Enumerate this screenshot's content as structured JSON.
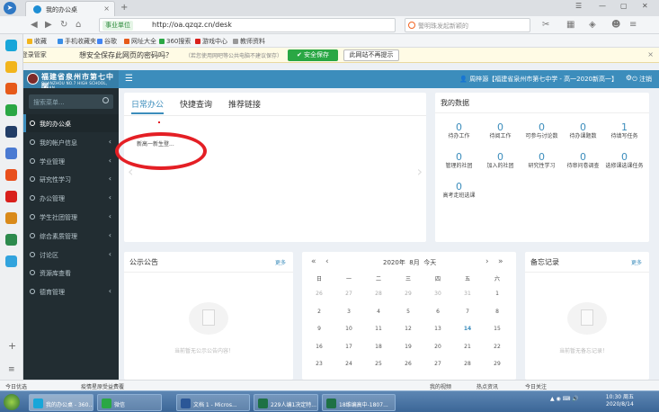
{
  "browser": {
    "tab_title": "我的办公桌",
    "url_badge": "事业单位",
    "url": "http://oa.qzqz.cn/desk",
    "search_placeholder": "警明珠发起新颖的",
    "bookmarks": [
      "收藏",
      "手机收藏夹",
      "谷歌",
      "网址大全",
      "360搜索",
      "游戏中心",
      "教师资料"
    ]
  },
  "password_bar": {
    "brand": "360",
    "brand_sub": "登录管家",
    "prompt": "想安全保存此网页的密码吗？",
    "hint": "（若您使用网吧等公共电脑不建议保存）",
    "save_label": "安全保存",
    "never_label": "此网站不再提示"
  },
  "header": {
    "school_cn": "福建省泉州市第七中学",
    "school_en": "QUANZHOU NO.7 HIGH SCHOOL, FUJIAN",
    "user": "周梓源【福建省泉州市第七中学 - 高一2020新高一】",
    "logout": "注销"
  },
  "sidebar": {
    "search_placeholder": "搜索菜单...",
    "items": [
      {
        "label": "我的办公桌",
        "active": true,
        "chevron": false
      },
      {
        "label": "我的帐户信息",
        "active": false,
        "chevron": true
      },
      {
        "label": "学业管理",
        "active": false,
        "chevron": true
      },
      {
        "label": "研究性学习",
        "active": false,
        "chevron": true
      },
      {
        "label": "办公管理",
        "active": false,
        "chevron": true
      },
      {
        "label": "学生社团管理",
        "active": false,
        "chevron": true
      },
      {
        "label": "综合素质管理",
        "active": false,
        "chevron": true
      },
      {
        "label": "讨论区",
        "active": false,
        "chevron": true
      },
      {
        "label": "资源库查看",
        "active": false,
        "chevron": false
      },
      {
        "label": "德育管理",
        "active": false,
        "chevron": true
      }
    ]
  },
  "office": {
    "tabs": [
      "日常办公",
      "快捷查询",
      "推荐链接"
    ],
    "notice": "新高一新生登..."
  },
  "my_data": {
    "title": "我的数据",
    "stats": [
      {
        "num": "0",
        "label": "待办工作"
      },
      {
        "num": "0",
        "label": "待阅工作"
      },
      {
        "num": "0",
        "label": "可参与讨论数"
      },
      {
        "num": "0",
        "label": "待办课题数"
      },
      {
        "num": "1",
        "label": "待填写任务"
      },
      {
        "num": "0",
        "label": "管理的社团"
      },
      {
        "num": "0",
        "label": "加入的社团"
      },
      {
        "num": "0",
        "label": "研究性学习"
      },
      {
        "num": "0",
        "label": "待审问卷调查"
      },
      {
        "num": "0",
        "label": "选修课选课任务"
      },
      {
        "num": "0",
        "label": "高考走班选课"
      }
    ]
  },
  "announce": {
    "title": "公示公告",
    "more": "更多",
    "empty": "当前暂无公示公告内容！"
  },
  "memo": {
    "title": "备忘记录",
    "more": "更多",
    "empty": "当前暂无备忘记录！"
  },
  "calendar": {
    "year": "2020年",
    "month": "8月",
    "today_label": "今天",
    "weekdays": [
      "日",
      "一",
      "二",
      "三",
      "四",
      "五",
      "六"
    ],
    "rows": [
      [
        "26",
        "27",
        "28",
        "29",
        "30",
        "31",
        "1"
      ],
      [
        "2",
        "3",
        "4",
        "5",
        "6",
        "7",
        "8"
      ],
      [
        "9",
        "10",
        "11",
        "12",
        "13",
        "14",
        "15"
      ],
      [
        "16",
        "17",
        "18",
        "19",
        "20",
        "21",
        "22"
      ],
      [
        "23",
        "24",
        "25",
        "26",
        "27",
        "28",
        "29"
      ]
    ]
  },
  "status_strip": {
    "left": "今日优选",
    "news": "疫情星原受益费覆",
    "right": [
      "我的视频",
      "热点资讯",
      "今日关注"
    ]
  },
  "taskbar": {
    "items": [
      "我的办公桌 - 360...",
      "微信",
      "文档 1 - Micros...",
      "229人编1决定特...",
      "18维编高中-1807..."
    ],
    "time": "10:30 周五",
    "date": "2020/8/14"
  },
  "colors": {
    "accent": "#3c8dbc",
    "sidebar": "#222d32",
    "annotation": "#e41f25"
  }
}
